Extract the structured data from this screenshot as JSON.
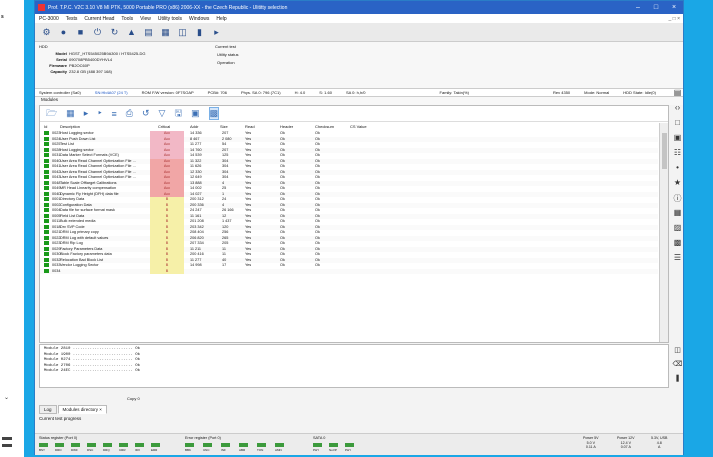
{
  "title": "Prof. T.P.C. V2C 3.10 V8 MI PTK, 5000 Portable PRO (x86) 2006-XX - the Czech Republic - Ulititty selection",
  "menu": [
    "PC-3000",
    "Tests",
    "Current Head",
    "Tools",
    "View",
    "Utility tools",
    "Windows",
    "Help"
  ],
  "toolbar_icons": [
    "cog-icon",
    "disk-icon",
    "tools-icon",
    "power-icon",
    "reset-icon",
    "play-icon",
    "info-icon",
    "chip-icon",
    "db-icon",
    "signal-icon",
    "arrow-right-icon"
  ],
  "info": {
    "hdd_label": "HDD",
    "model_key": "Model",
    "model": "HGST_HTS545025B9A300 / HTS5425-DG",
    "serial_key": "Serial",
    "serial": "090708PB5400DYHVL4",
    "firmware_key": "Firmware",
    "firmware": "PB2OC60P",
    "capacity_key": "Capacity",
    "capacity": "232.8 GB (488 397 168)",
    "current_test_label": "Current test",
    "utility_status_label": "Utility status",
    "operation_label": "Operation"
  },
  "statusline": {
    "controller": "System controller (Sa0)",
    "sa_data": "SN:Hb4A07 (24 T)",
    "rom_fw": "ROM F/W version: 0F7SOAP",
    "pcb": "PCB#: 706",
    "phys": "Phys. SA 0: 796 (7C1)",
    "head": "H: 4.0",
    "sn": "S: 1.60",
    "sa_g": "SA 0: h,h/0",
    "family": "Family: Takin(%)",
    "rev": "Rev 4350",
    "mode": "Mode: Normal",
    "hdd_state": "HDD State: Idle(0)"
  },
  "modules_label": "Modules",
  "columns": [
    "Id",
    "Description",
    "Critical",
    "Addr",
    "Size",
    "Read",
    "Header",
    "Checksum",
    "CS Value"
  ],
  "rows": [
    {
      "id": "0023",
      "desc": "Host Logging sector",
      "crit": "Acc",
      "color": "#f2b8c6",
      "addr": "14 336",
      "size": "207",
      "read": "Yes",
      "header": "Ok",
      "cs": "Ok"
    },
    {
      "id": "0024",
      "desc": "User Push Down List",
      "crit": "Acc",
      "color": "#f2b8c6",
      "addr": "8 467",
      "size": "2 080",
      "read": "Yes",
      "header": "Ok",
      "cs": "Ok"
    },
    {
      "id": "0025",
      "desc": "Test List",
      "crit": "Acc",
      "color": "#f2b8c6",
      "addr": "11 277",
      "size": "54",
      "read": "Yes",
      "header": "Ok",
      "cs": "Ok"
    },
    {
      "id": "0028",
      "desc": "Host Logging sector",
      "crit": "Acc",
      "color": "#f2b8c6",
      "addr": "14 760",
      "size": "207",
      "read": "Yes",
      "header": "Ok",
      "cs": "Ok"
    },
    {
      "id": "0031",
      "desc": "Data Marker Select Formats (VCE)",
      "crit": "Acc",
      "color": "#f2b8c6",
      "addr": "14 539",
      "size": "125",
      "read": "Yes",
      "header": "Ok",
      "cs": "Ok"
    },
    {
      "id": "0040",
      "desc": "User Area Read Channel Optimization File ...",
      "crit": "Acc",
      "color": "#f1a6a6",
      "addr": "11 322",
      "size": "304",
      "read": "Yes",
      "header": "Ok",
      "cs": "Ok"
    },
    {
      "id": "0041",
      "desc": "User Area Read Channel Optimization File ...",
      "crit": "Acc",
      "color": "#f1a6a6",
      "addr": "11 626",
      "size": "304",
      "read": "Yes",
      "header": "Ok",
      "cs": "Ok"
    },
    {
      "id": "0042",
      "desc": "User Area Read Channel Optimization File ...",
      "crit": "Acc",
      "color": "#f1a6a6",
      "addr": "12 330",
      "size": "304",
      "read": "Yes",
      "header": "Ok",
      "cs": "Ok"
    },
    {
      "id": "0043",
      "desc": "User Area Read Channel Optimization File ...",
      "crit": "Acc",
      "color": "#f1a6a6",
      "addr": "12 649",
      "size": "304",
      "read": "Yes",
      "header": "Ok",
      "cs": "Ok"
    },
    {
      "id": "0048",
      "desc": "Table Scale Offtarget Calibrations",
      "crit": "Acc",
      "color": "#f1a6a6",
      "addr": "13 888",
      "size": "4",
      "read": "Yes",
      "header": "Ok",
      "cs": "Ok"
    },
    {
      "id": "0049",
      "desc": "MR Head Linearity compensation",
      "crit": "Acc",
      "color": "#f1a6a6",
      "addr": "14 002",
      "size": "25",
      "read": "Yes",
      "header": "Ok",
      "cs": "Ok"
    },
    {
      "id": "004D",
      "desc": "Dynamic Fly Height (DFH) data file",
      "crit": "Acc",
      "color": "#f1a6a6",
      "addr": "14 027",
      "size": "1",
      "read": "Yes",
      "header": "Ok",
      "cs": "Ok"
    },
    {
      "id": "0001",
      "desc": "Directory Data",
      "crit": "B",
      "color": "#f6f0a8",
      "addr": "200 312",
      "size": "24",
      "read": "Yes",
      "header": "Ok",
      "cs": "Ok"
    },
    {
      "id": "0002",
      "desc": "Configuration Data",
      "crit": "B",
      "color": "#f6f0a8",
      "addr": "200 336",
      "size": "4",
      "read": "Yes",
      "header": "Ok",
      "cs": "Ok"
    },
    {
      "id": "0004",
      "desc": "Data file for surface format mask",
      "crit": "B",
      "color": "#f6f0a8",
      "addr": "24 247",
      "size": "26 166",
      "read": "Yes",
      "header": "Ok",
      "cs": "Ok"
    },
    {
      "id": "0005",
      "desc": "Field List Data",
      "crit": "B",
      "color": "#f6f0a8",
      "addr": "11 161",
      "size": "12",
      "read": "Yes",
      "header": "Ok",
      "cs": "Ok"
    },
    {
      "id": "0011",
      "desc": "Bulk extended media",
      "crit": "B",
      "color": "#f6f0a8",
      "addr": "201 208",
      "size": "1 437",
      "read": "Yes",
      "header": "Ok",
      "cs": "Ok"
    },
    {
      "id": "0018",
      "desc": "Drv SVP Code",
      "crit": "B",
      "color": "#f6f0a8",
      "addr": "203 342",
      "size": "120",
      "read": "Yes",
      "header": "Ok",
      "cs": "Ok"
    },
    {
      "id": "0021",
      "desc": "DRM Log primary copy",
      "crit": "B",
      "color": "#f6f0a8",
      "addr": "208 404",
      "size": "256",
      "read": "Yes",
      "header": "Ok",
      "cs": "Ok"
    },
    {
      "id": "0022",
      "desc": "DRM Log with default values",
      "crit": "B",
      "color": "#f6f0a8",
      "addr": "206 820",
      "size": "265",
      "read": "Yes",
      "header": "Ok",
      "cs": "Ok"
    },
    {
      "id": "0023",
      "desc": "DRM Rip Log",
      "crit": "B",
      "color": "#f6f0a8",
      "addr": "207 334",
      "size": "205",
      "read": "Yes",
      "header": "Ok",
      "cs": "Ok"
    },
    {
      "id": "0029",
      "desc": "Factory Parameters Data",
      "crit": "B",
      "color": "#f6f0a8",
      "addr": "11 211",
      "size": "11",
      "read": "Yes",
      "header": "Ok",
      "cs": "Ok"
    },
    {
      "id": "0030",
      "desc": "Block Factory parameters data",
      "crit": "B",
      "color": "#f6f0a8",
      "addr": "200 416",
      "size": "11",
      "read": "Yes",
      "header": "Ok",
      "cs": "Ok"
    },
    {
      "id": "0032",
      "desc": "Relocation Bad Block List",
      "crit": "B",
      "color": "#f6f0a8",
      "addr": "11 277",
      "size": "40",
      "read": "Yes",
      "header": "Ok",
      "cs": "Ok"
    },
    {
      "id": "0033",
      "desc": "Vendor Logging Sector",
      "crit": "B",
      "color": "#f6f0a8",
      "addr": "14 998",
      "size": "17",
      "read": "Yes",
      "header": "Ok",
      "cs": "Ok"
    },
    {
      "id": "0034",
      "desc": "",
      "crit": "B",
      "color": "#f6f0a8",
      "addr": "",
      "size": "",
      "read": "",
      "header": "",
      "cs": ""
    }
  ],
  "log": [
    "Module 2810 ......................... Ok",
    "Module 1900 ......................... Ok",
    "Module 0274 ......................... Ok",
    "Module 2706 ......................... Ok",
    "Module 24EC ......................... Ok"
  ],
  "copy_label": "Copy 0",
  "tabs": [
    "Log",
    "Modules directory"
  ],
  "current_progress": "Current test progress",
  "bottom": {
    "status_register_label": "Status register (Port 0)",
    "status_bits": [
      "BSY",
      "DRD",
      "DWF",
      "DSC",
      "DRQ",
      "CRR",
      "IDX",
      "ERR"
    ],
    "error_register_label": "Error register (Port 0)",
    "error_bits": [
      "BBK",
      "UNC",
      "INF",
      "ABR",
      "TON",
      "AMN"
    ],
    "sata_label": "SATA 0",
    "sata_bits": [
      "PHY",
      "NoVP",
      "PHY"
    ],
    "power5_label": "Power 5V",
    "power5_values": [
      "5.0 V",
      "0.11 A"
    ],
    "power12_label": "Power 12V",
    "power12_values": [
      "12.4 V",
      "0.07 A"
    ],
    "usb_label": "5.3V, USB",
    "usb_values": [
      "4.8",
      "A"
    ]
  },
  "right_tools": [
    "filter-icon",
    "code-icon",
    "page-icon",
    "hdd-icon",
    "chart-icon",
    "dots-icon",
    "star-icon",
    "id-icon",
    "grid-icon",
    "stack-icon",
    "db-icon",
    "list-icon"
  ],
  "left_strip_label": "s"
}
